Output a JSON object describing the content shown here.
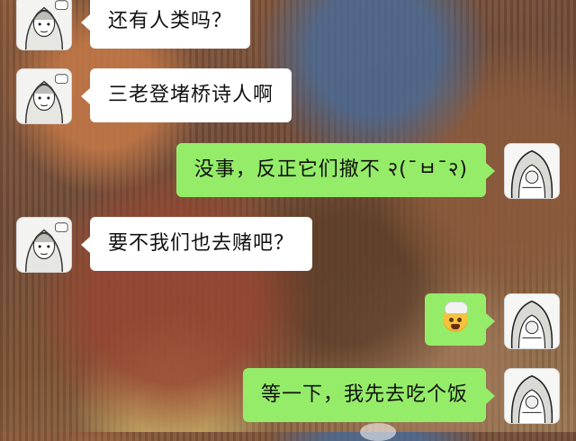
{
  "chat": {
    "messages": [
      {
        "side": "left",
        "sender": "friend",
        "text": "还有人类吗？"
      },
      {
        "side": "left",
        "sender": "friend",
        "text": "三老登堵桥诗人啊"
      },
      {
        "side": "right",
        "sender": "me",
        "text": "没事，反正它们撤不 २(¯ㅂ¯२)"
      },
      {
        "side": "left",
        "sender": "friend",
        "text": "要不我们也去赌吧？"
      },
      {
        "side": "right",
        "sender": "me",
        "emoji": "exploding-head-emoji"
      },
      {
        "side": "right",
        "sender": "me",
        "text": "等一下，我先去吃个饭"
      }
    ]
  },
  "colors": {
    "outgoing_bubble": "#95ec69",
    "incoming_bubble": "#ffffff"
  },
  "icons": {
    "friend_avatar": "manga-girl-avatar",
    "me_avatar": "manga-hooded-avatar"
  }
}
